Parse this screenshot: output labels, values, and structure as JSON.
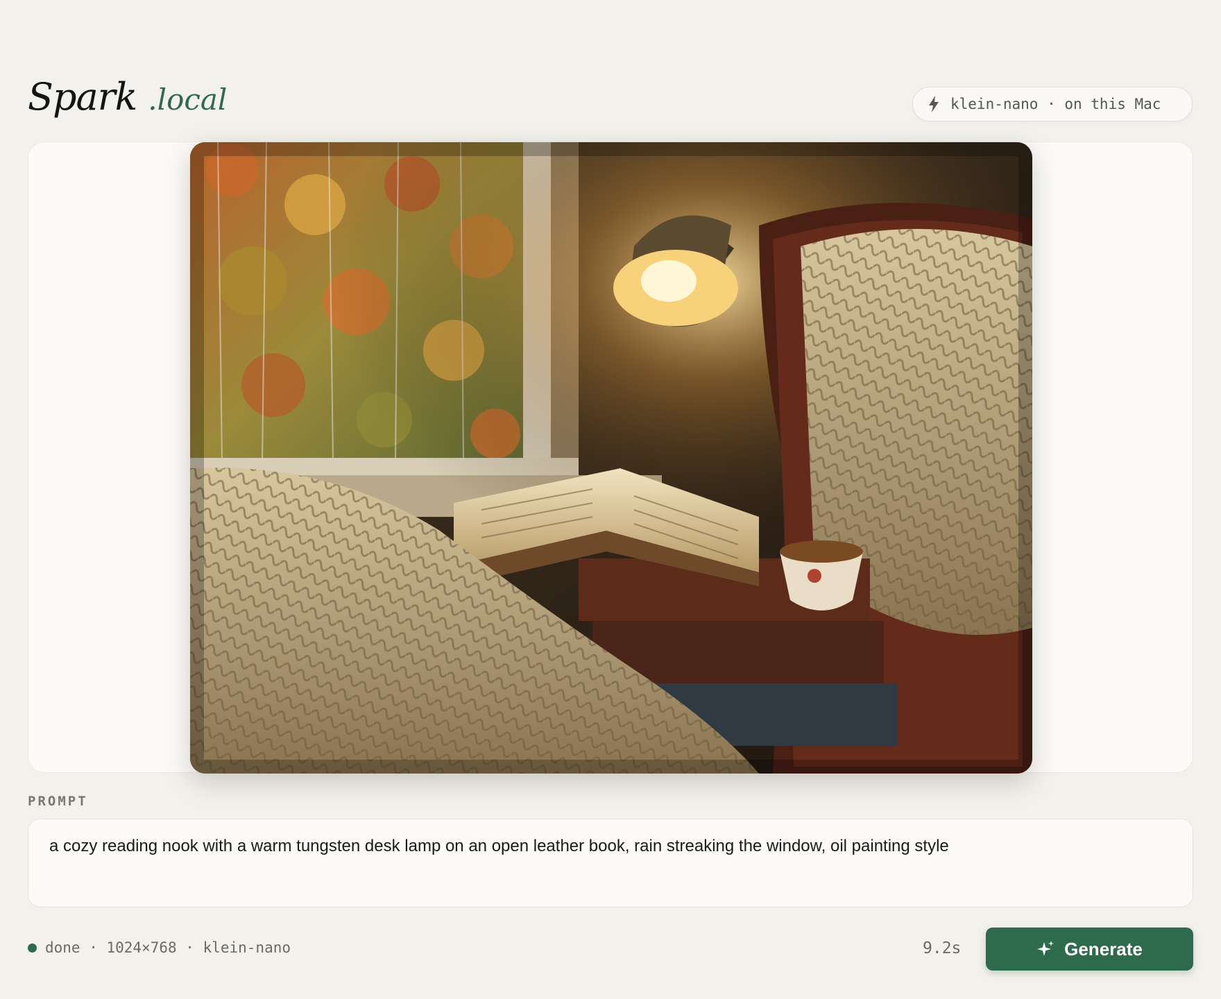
{
  "header": {
    "brand_name": "Spark",
    "brand_suffix": ".local",
    "model_badge": "klein-nano · on this Mac"
  },
  "canvas": {
    "image_alt": "oil painting of a cozy reading nook with a desk lamp, open book, knit blanket and tea cup by a rainy window"
  },
  "prompt": {
    "label": "PROMPT",
    "value": "a cozy reading nook with a warm tungsten desk lamp on an open leather book, rain streaking the window, oil painting style"
  },
  "status": {
    "text": "done · 1024×768 · klein-nano",
    "state_color": "#2e6b4d",
    "elapsed": "9.2s"
  },
  "actions": {
    "generate_label": "Generate",
    "accent": "#2e6b4d"
  },
  "icons": {
    "model_badge": "bolt-icon",
    "generate": "sparkle-icon"
  }
}
